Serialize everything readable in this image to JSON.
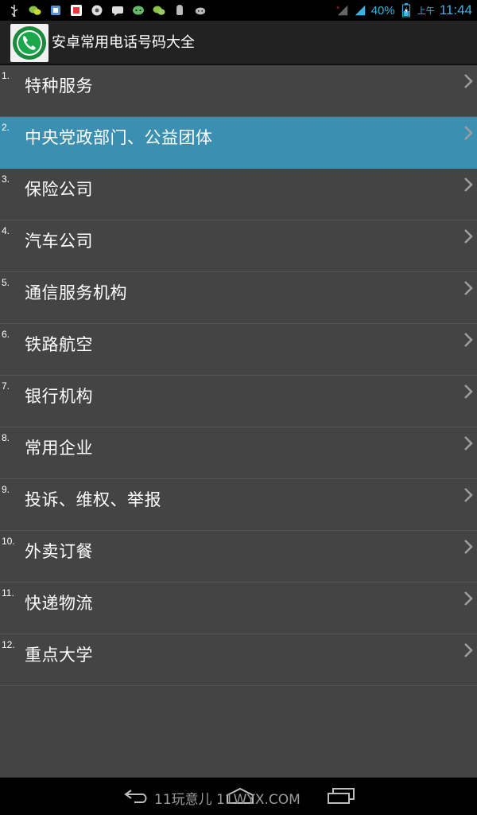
{
  "status_bar": {
    "battery": "40%",
    "ampm": "上午",
    "time": "11:44",
    "icons": [
      "usb-icon",
      "wechat-icon",
      "notification-icon",
      "app-icon",
      "settings-icon",
      "message-icon",
      "chat-icon",
      "wechat-icon",
      "android-icon",
      "android-icon"
    ]
  },
  "title_bar": {
    "title": "安卓常用电话号码大全"
  },
  "list": {
    "items": [
      {
        "num": "1.",
        "label": "特种服务"
      },
      {
        "num": "2.",
        "label": "中央党政部门、公益团体"
      },
      {
        "num": "3.",
        "label": "保险公司"
      },
      {
        "num": "4.",
        "label": "汽车公司"
      },
      {
        "num": "5.",
        "label": "通信服务机构"
      },
      {
        "num": "6.",
        "label": "铁路航空"
      },
      {
        "num": "7.",
        "label": "银行机构"
      },
      {
        "num": "8.",
        "label": "常用企业"
      },
      {
        "num": "9.",
        "label": "投诉、维权、举报"
      },
      {
        "num": "10.",
        "label": "外卖订餐"
      },
      {
        "num": "11.",
        "label": "快递物流"
      },
      {
        "num": "12.",
        "label": "重点大学"
      }
    ],
    "selected_index": 1
  },
  "nav_bar": {
    "watermark": "11玩意儿 11WYX.COM"
  },
  "colors": {
    "accent": "#33b5e5",
    "selected_row": "#3b8fb0",
    "list_bg": "#444444"
  }
}
